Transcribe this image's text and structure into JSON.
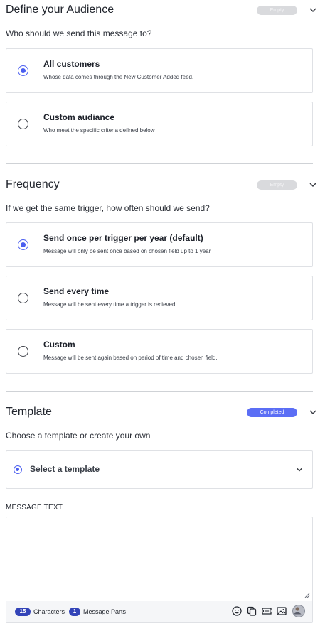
{
  "audience": {
    "title": "Define your Audience",
    "badge": "Empty",
    "question": "Who should we send this message to?",
    "options": [
      {
        "title": "All customers",
        "desc": "Whose data comes through the New Customer Added feed.",
        "checked": true
      },
      {
        "title": "Custom audiance",
        "desc": "Who meet the specific criteria defined below",
        "checked": false
      }
    ]
  },
  "frequency": {
    "title": "Frequency",
    "badge": "Empty",
    "question": "If we get the same trigger, how often should we send?",
    "options": [
      {
        "title": "Send once per trigger per year (default)",
        "desc": "Message will only be sent once based on chosen field up to 1 year",
        "checked": true
      },
      {
        "title": "Send every time",
        "desc": "Message will be sent every time a trigger is recieved.",
        "checked": false
      },
      {
        "title": "Custom",
        "desc": "Message will be sent again based on period of time and chosen field.",
        "checked": false
      }
    ]
  },
  "template": {
    "title": "Template",
    "badge": "Completed",
    "question": "Choose a template or create your own",
    "select_label": "Select a template"
  },
  "message": {
    "label": "MESSAGE TEXT",
    "text": "",
    "characters_count": "15",
    "characters_label": "Characters",
    "parts_count": "1",
    "parts_label": "Message Parts"
  },
  "colors": {
    "accent": "#4a5ef0",
    "badge_completed": "#5b6ef5",
    "badge_empty": "#d9dadd",
    "count_pill": "#3344b8"
  },
  "icons": [
    "chevron-down-icon",
    "emoji-icon",
    "copy-icon",
    "ticket-icon",
    "image-icon",
    "avatar"
  ]
}
